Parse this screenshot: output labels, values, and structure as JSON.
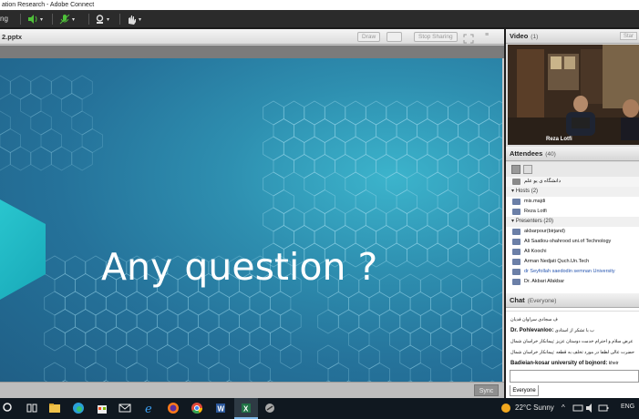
{
  "window": {
    "title": "ation Research - Adobe Connect"
  },
  "toolbar": {
    "label": "ng"
  },
  "share_pod": {
    "file_name": "2.pptx",
    "draw_label": "Draw",
    "stop_sharing_label": "Stop Sharing",
    "slide_title": "Any question ?",
    "sync_label": "Sync"
  },
  "video_pod": {
    "title": "Video",
    "count": "(1)",
    "start_label": "Star",
    "presenter_name": "Reza Lotfi"
  },
  "attendees_pod": {
    "title": "Attendees",
    "count": "(40)",
    "top_row": "دانشگاه ی یو علم",
    "hosts_header": "Hosts (2)",
    "hosts": [
      "mis.majdi",
      "Reza Lotfi"
    ],
    "presenters_header": "Presenters (20)",
    "presenters": [
      "akbarpour(birjand)",
      "Ali Saatlou-shahrood uni.of Technology",
      "Ali Koochi",
      "Arman Nedjati Quch.Un.Tech",
      "dr Seyfollah saedodin semnan University",
      "Dr. Akbari Afakbar"
    ]
  },
  "chat_pod": {
    "title": "Chat",
    "scope": "(Everyone)",
    "messages": [
      {
        "sender": "",
        "text": "ف سجادی سراوان فدیان"
      },
      {
        "sender": "Dr. Pohlevanloo:",
        "text": "ب با تشکر از استادی"
      },
      {
        "sender": "",
        "text": "عرض سلام و احترام خدمت دوستان عزیز :پیمانکار خراسان شمال"
      },
      {
        "sender": "",
        "text": "حضرت عالی لطفا در مورد تخلف به قطعه :پیمانکار خراسان شمال"
      },
      {
        "sender": "Badieian-kosar university of bojnord:",
        "text": "kheir"
      }
    ],
    "tab_label": "Everyone"
  },
  "taskbar": {
    "weather": "22°C Sunny",
    "lang": "ENG"
  }
}
